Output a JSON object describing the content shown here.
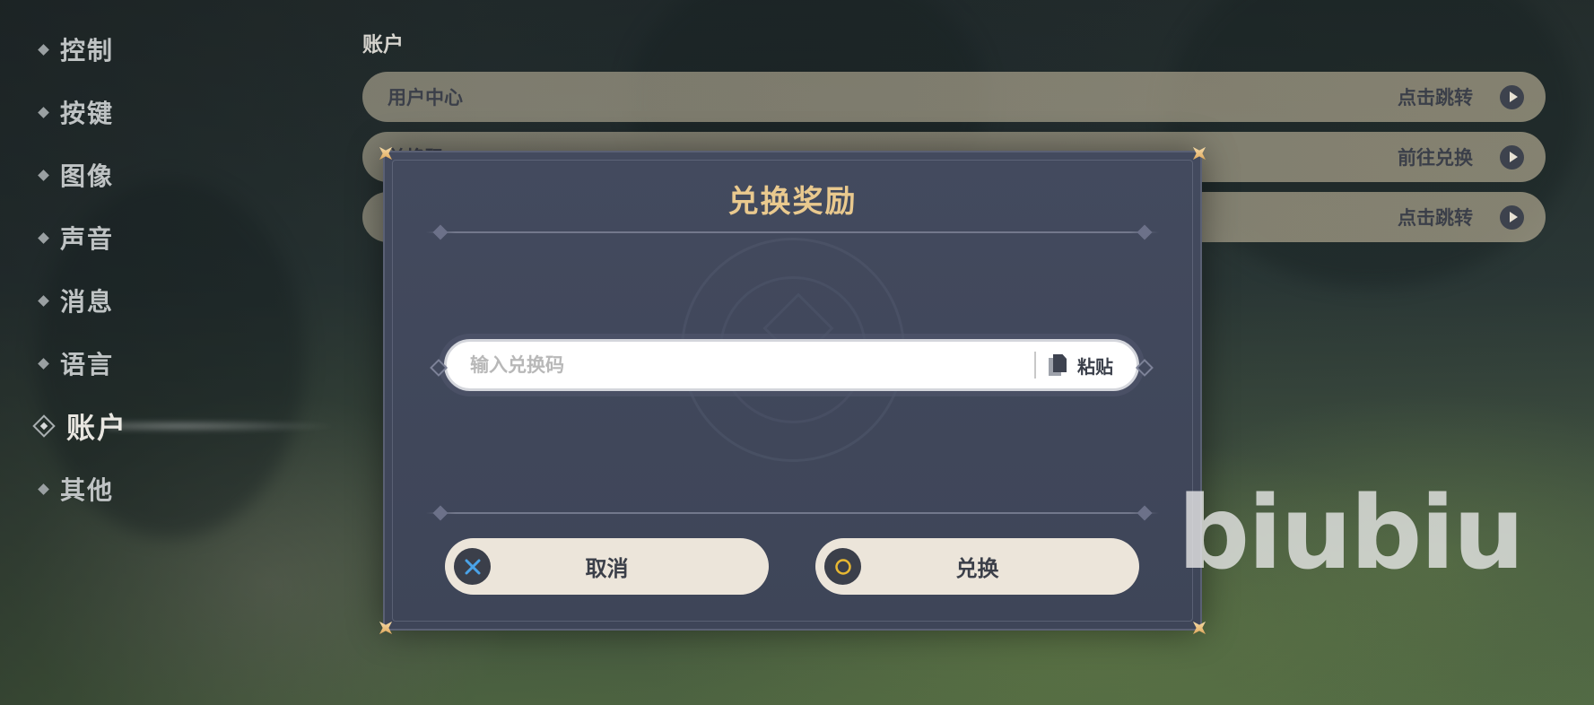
{
  "nav": {
    "items": [
      {
        "label": "控制"
      },
      {
        "label": "按键"
      },
      {
        "label": "图像"
      },
      {
        "label": "声音"
      },
      {
        "label": "消息"
      },
      {
        "label": "语言"
      },
      {
        "label": "账户",
        "active": true
      },
      {
        "label": "其他"
      }
    ]
  },
  "account": {
    "section_title": "账户",
    "rows": [
      {
        "label": "用户中心",
        "action": "点击跳转"
      },
      {
        "label": "兑换码",
        "action": "前往兑换"
      },
      {
        "label": "",
        "action": "点击跳转"
      }
    ]
  },
  "modal": {
    "title": "兑换奖励",
    "input_placeholder": "输入兑换码",
    "input_value": "",
    "paste_label": "粘贴",
    "cancel_label": "取消",
    "confirm_label": "兑换"
  },
  "watermark": "biubiu",
  "colors": {
    "modal_bg": "#434a5e",
    "title_gold": "#e9c98e",
    "button_bg": "#ece5da",
    "cancel_icon": "#4aa3e8",
    "confirm_icon": "#e8b832"
  }
}
